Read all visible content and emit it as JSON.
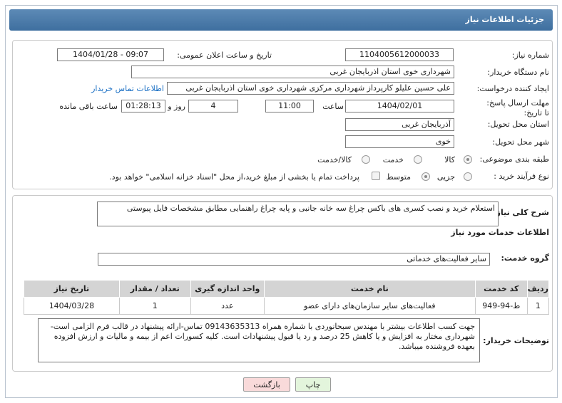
{
  "header": {
    "title": "جزئیات اطلاعات نیاز"
  },
  "fields": {
    "need_number_label": "شماره نیاز:",
    "need_number": "1104005612000033",
    "announce_label": "تاریخ و ساعت اعلان عمومی:",
    "announce_value": "1404/01/28 - 09:07",
    "buyer_org_label": "نام دستگاه خریدار:",
    "buyer_org": "شهرداری خوی استان اذربایجان غربی",
    "requester_label": "ایجاد کننده درخواست:",
    "requester": "علی حسین علیلو کارپرداز شهرداری مرکزی شهرداری خوی استان اذربایجان غربی",
    "buyer_contact_link": "اطلاعات تماس خریدار",
    "deadline_label": "مهلت ارسال پاسخ: تا تاریخ:",
    "deadline_date": "1404/02/01",
    "time_label": "ساعت",
    "deadline_time": "11:00",
    "days_value": "4",
    "days_label": "روز و",
    "remaining_time": "01:28:13",
    "remaining_label": "ساعت باقی مانده",
    "province_label": "استان محل تحویل:",
    "province": "آذربایجان غربی",
    "city_label": "شهر محل تحویل:",
    "city": "خوی",
    "category_label": "طبقه بندی موضوعی:",
    "category_options": [
      "کالا",
      "خدمت",
      "کالا/خدمت"
    ],
    "process_label": "نوع فرآیند خرید :",
    "process_options": [
      "جزیی",
      "متوسط"
    ],
    "payment_note": "پرداخت تمام یا بخشی از مبلغ خرید،از محل \"اسناد خزانه اسلامی\" خواهد بود."
  },
  "description": {
    "label": "شرح کلی نیاز:",
    "text": "استعلام خرید و نصب کسری های باکس چراغ سه خانه جانبی و پایه چراغ راهنمایی مطابق مشخصات فایل پیوستی"
  },
  "services": {
    "title": "اطلاعات خدمات مورد نیاز",
    "group_label": "گروه خدمت:",
    "group_value": "سایر فعالیت‌های خدماتی",
    "columns": [
      "ردیف",
      "کد خدمت",
      "نام خدمت",
      "واحد اندازه گیری",
      "تعداد / مقدار",
      "تاریخ نیاز"
    ],
    "rows": [
      [
        "1",
        "ط-94-949",
        "فعالیت‌های سایر سازمان‌های دارای عضو",
        "عدد",
        "1",
        "1404/03/28"
      ]
    ]
  },
  "buyer_notes": {
    "label": "توضیحات خریدار:",
    "text": "جهت کسب اطلاعات بیشتر با مهندس سبحانوردی با شماره همراه 09143635313 تماس-ارائه پیشنهاد در قالب فرم الزامی است-شهرداری مختار به افزایش و یا کاهش 25 درصد و رد یا قبول پیشنهادات است. کلیه کسورات اعم از بیمه و مالیات و ارزش افزوده بعهده فروشنده میباشد."
  },
  "buttons": {
    "print": "چاپ",
    "back": "بازگشت"
  },
  "colors": {
    "header": "#4a79a8",
    "link": "#1a6fc4",
    "back_button": "#f9dada",
    "print_button": "#e3f5dc"
  }
}
